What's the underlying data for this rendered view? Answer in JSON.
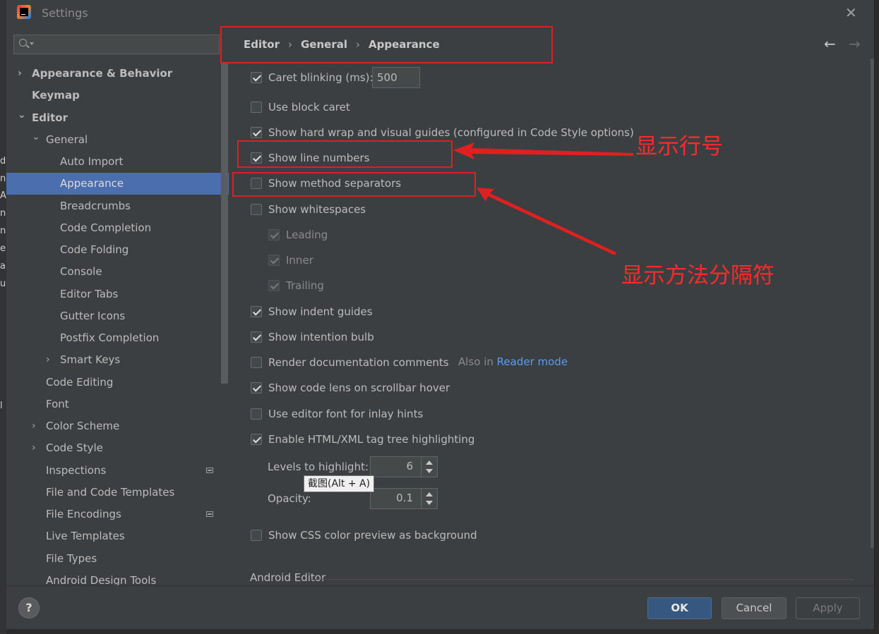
{
  "window": {
    "title": "Settings",
    "close_glyph": "✕"
  },
  "left_edge_chars": [
    "d",
    "n",
    "A",
    "n",
    "n",
    "e",
    "a",
    "u",
    "l"
  ],
  "search": {
    "placeholder": "",
    "icon": "search-icon"
  },
  "tree": [
    {
      "label": "Appearance & Behavior",
      "chevron": "›"
    },
    {
      "label": "Keymap"
    },
    {
      "label": "Editor",
      "chevron": "⌄"
    },
    {
      "label": "General",
      "chevron": "⌄"
    },
    {
      "label": "Auto Import"
    },
    {
      "label": "Appearance",
      "selected": true
    },
    {
      "label": "Breadcrumbs"
    },
    {
      "label": "Code Completion"
    },
    {
      "label": "Code Folding"
    },
    {
      "label": "Console"
    },
    {
      "label": "Editor Tabs"
    },
    {
      "label": "Gutter Icons"
    },
    {
      "label": "Postfix Completion"
    },
    {
      "label": "Smart Keys",
      "chevron": "›"
    },
    {
      "label": "Code Editing"
    },
    {
      "label": "Font"
    },
    {
      "label": "Color Scheme",
      "chevron": "›"
    },
    {
      "label": "Code Style",
      "chevron": "›"
    },
    {
      "label": "Inspections",
      "icon": "project-settings-icon"
    },
    {
      "label": "File and Code Templates"
    },
    {
      "label": "File Encodings",
      "icon": "project-settings-icon"
    },
    {
      "label": "Live Templates"
    },
    {
      "label": "File Types"
    },
    {
      "label": "Android Design Tools"
    }
  ],
  "breadcrumb": {
    "items": [
      "Editor",
      "General",
      "Appearance"
    ],
    "separator": "›"
  },
  "nav": {
    "back": "←",
    "forward": "→"
  },
  "options": {
    "caret_blinking": {
      "label": "Caret blinking (ms):",
      "checked": true,
      "value": "500"
    },
    "block_caret": {
      "label": "Use block caret",
      "checked": false
    },
    "hard_wrap": {
      "label": "Show hard wrap and visual guides (configured in Code Style options)",
      "checked": true
    },
    "line_numbers": {
      "label": "Show line numbers",
      "checked": true
    },
    "method_separators": {
      "label": "Show method separators",
      "checked": false
    },
    "whitespaces": {
      "label": "Show whitespaces",
      "checked": false
    },
    "leading": {
      "label": "Leading",
      "checked": true,
      "disabled": true
    },
    "inner": {
      "label": "Inner",
      "checked": true,
      "disabled": true
    },
    "trailing": {
      "label": "Trailing",
      "checked": true,
      "disabled": true
    },
    "indent_guides": {
      "label": "Show indent guides",
      "checked": true
    },
    "intention_bulb": {
      "label": "Show intention bulb",
      "checked": true
    },
    "render_docs": {
      "label": "Render documentation comments",
      "checked": false,
      "hint": "Also in",
      "link": "Reader mode"
    },
    "code_lens": {
      "label": "Show code lens on scrollbar hover",
      "checked": true
    },
    "inlay_font": {
      "label": "Use editor font for inlay hints",
      "checked": false
    },
    "tag_tree": {
      "label": "Enable HTML/XML tag tree highlighting",
      "checked": true
    },
    "levels": {
      "label": "Levels to highlight:",
      "value": "6"
    },
    "opacity": {
      "label": "Opacity:",
      "value": "0.1"
    },
    "css_color": {
      "label": "Show CSS color preview as background",
      "checked": false
    }
  },
  "tooltip": "截图(Alt + A)",
  "section": "Android Editor",
  "annotations": {
    "line_numbers": "显示行号",
    "method_separators": "显示方法分隔符",
    "color": "#e02020"
  },
  "buttons": {
    "help": "?",
    "ok": "OK",
    "cancel": "Cancel",
    "apply": "Apply"
  }
}
